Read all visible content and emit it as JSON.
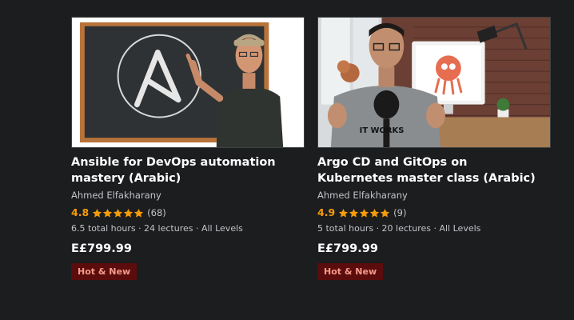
{
  "courses": [
    {
      "title": "Ansible for DevOps automation mastery (Arabic)",
      "author": "Ahmed Elfakharany",
      "rating": "4.8",
      "stars": 5,
      "reviews": "(68)",
      "meta": "6.5 total hours · 24 lectures · All Levels",
      "price": "E£799.99",
      "badge": "Hot & New"
    },
    {
      "title": "Argo CD and GitOps on Kubernetes master class (Arabic)",
      "author": "Ahmed Elfakharany",
      "rating": "4.9",
      "stars": 5,
      "reviews": "(9)",
      "meta": "5 total hours · 20 lectures · All Levels",
      "price": "E£799.99",
      "badge": "Hot & New",
      "thumbnail_text": "IT WORKS"
    }
  ],
  "colors": {
    "background": "#1c1d1f",
    "rating": "#f69c08",
    "badge_bg": "#5b0c0c",
    "badge_text": "#f79a8b"
  }
}
